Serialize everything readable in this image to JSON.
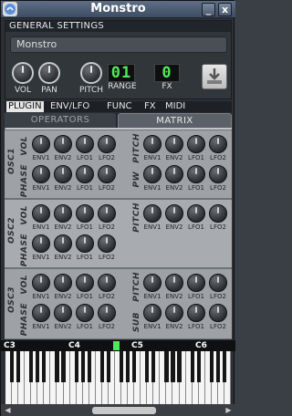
{
  "window": {
    "title": "Monstro",
    "minimize_glyph": "_",
    "close_glyph": "x"
  },
  "general": {
    "header": "GENERAL SETTINGS",
    "preset_name": "Monstro",
    "knobs": [
      {
        "label": "VOL"
      },
      {
        "label": "PAN"
      },
      {
        "label": "PITCH"
      }
    ],
    "range": {
      "label": "RANGE",
      "value": "01"
    },
    "fx": {
      "label": "FX",
      "value": "0"
    }
  },
  "tabs": [
    "PLUGIN",
    "ENV/LFO",
    "FUNC",
    "FX",
    "MIDI"
  ],
  "subtabs": {
    "operators": "OPERATORS",
    "matrix": "MATRIX"
  },
  "modulators": [
    "ENV1",
    "ENV2",
    "LFO1",
    "LFO2"
  ],
  "matrix": {
    "osc1": {
      "label": "OSC1",
      "rows_left": [
        "VOL",
        "PHASE"
      ],
      "rows_right": [
        "PITCH",
        "PW"
      ]
    },
    "osc2": {
      "label": "OSC2",
      "rows_left": [
        "VOL",
        "PHASE"
      ],
      "rows_right": [
        "PITCH"
      ]
    },
    "osc3": {
      "label": "OSC3",
      "rows_left": [
        "VOL",
        "PHASE"
      ],
      "rows_right": [
        "PITCH",
        "SUB"
      ]
    }
  },
  "keyboard": {
    "octaves": [
      "C3",
      "C4",
      "C5",
      "C6"
    ]
  },
  "colors": {
    "accent_lcd": "#53e85a",
    "titlebar": "#4b5a70"
  }
}
